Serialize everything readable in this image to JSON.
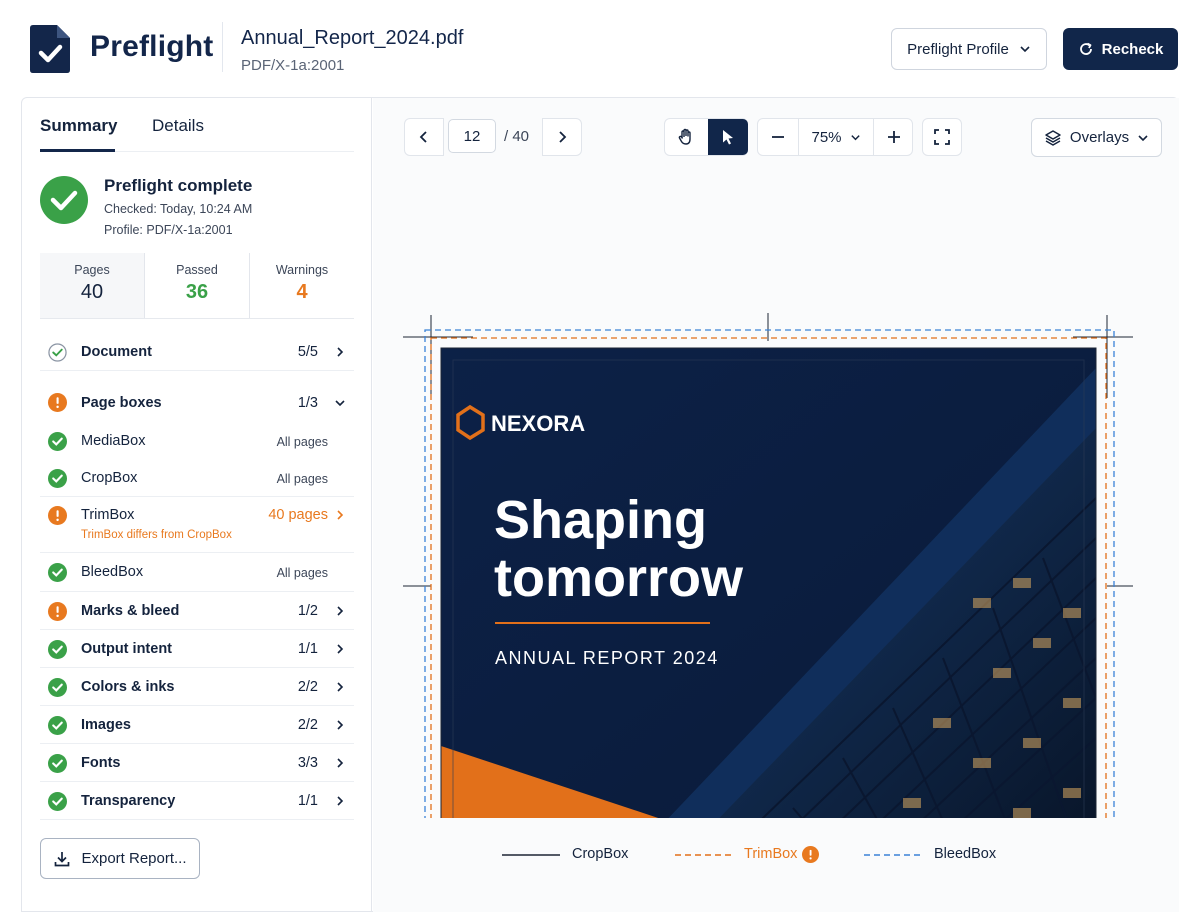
{
  "header": {
    "brand": "Preflight",
    "file_name": "Annual_Report_2024.pdf",
    "file_standard": "PDF/X-1a:2001",
    "profile_button": "Preflight Profile",
    "recheck_button": "Recheck"
  },
  "tabs": [
    {
      "label": "Summary",
      "active": true
    },
    {
      "label": "Details",
      "active": false
    }
  ],
  "status": {
    "title": "Preflight complete",
    "checked": "Checked: Today, 10:24 AM",
    "profile": "Profile: PDF/X-1a:2001"
  },
  "stats": {
    "pages_label": "Pages",
    "pages_value": "40",
    "passed_label": "Passed",
    "passed_value": "36",
    "warnings_label": "Warnings",
    "warnings_value": "4"
  },
  "checks": [
    {
      "label": "Document",
      "count": "5/5",
      "status": "pass-outline"
    },
    {
      "label": "Page boxes",
      "count": "1/3",
      "status": "warning",
      "expanded": true
    },
    {
      "label": "MediaBox",
      "scope": "All pages",
      "status": "pass"
    },
    {
      "label": "CropBox",
      "scope": "All pages",
      "status": "pass"
    },
    {
      "label": "TrimBox",
      "scope": "40 pages",
      "status": "warning",
      "note": "TrimBox differs from CropBox"
    },
    {
      "label": "BleedBox",
      "scope": "All pages",
      "status": "pass"
    },
    {
      "label": "Marks & bleed",
      "count": "1/2",
      "status": "warning"
    },
    {
      "label": "Output intent",
      "count": "1/1",
      "status": "pass"
    },
    {
      "label": "Colors & inks",
      "count": "2/2",
      "status": "pass"
    },
    {
      "label": "Images",
      "count": "2/2",
      "status": "pass"
    },
    {
      "label": "Fonts",
      "count": "3/3",
      "status": "pass"
    },
    {
      "label": "Transparency",
      "count": "1/1",
      "status": "pass"
    }
  ],
  "export_button": "Export Report...",
  "toolbar": {
    "current_page": "12",
    "total_pages": "/ 40",
    "zoom": "75%",
    "overlays": "Overlays"
  },
  "page_preview": {
    "brand": "NEXORA",
    "headline_1": "Shaping",
    "headline_2": "tomorrow",
    "subtitle": "ANNUAL REPORT 2024"
  },
  "legend": {
    "cropbox": "CropBox",
    "trimbox": "TrimBox",
    "bleedbox": "BleedBox"
  },
  "colors": {
    "navy": "#11264a",
    "green": "#3aa148",
    "orange": "#e8791f",
    "blue": "#3b82d6"
  }
}
